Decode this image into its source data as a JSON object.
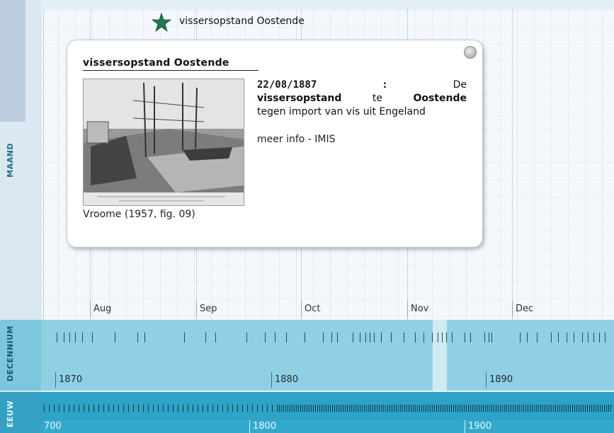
{
  "event": {
    "star_label": "vissersopstand Oostende",
    "popup_title": "vissersopstand Oostende",
    "date": "22/08/1887",
    "colon": ":",
    "desc_de": "De",
    "desc_word1": "vissersopstand",
    "desc_te": "te",
    "desc_place": "Oostende",
    "desc_rest": "tegen import van vis uit Engeland",
    "link": "meer info - IMIS",
    "source": "Vroome (1957, fig. 09)"
  },
  "bands": {
    "maand_label": "MAAND",
    "decennium_label": "DECENNIUM",
    "eeuw_label": "EEUW"
  },
  "months": [
    "Aug",
    "Sep",
    "Oct",
    "Nov",
    "Dec"
  ],
  "decades": [
    "1870",
    "1880",
    "1890"
  ],
  "centuries": [
    "700",
    "1800",
    "1900"
  ],
  "colors": {
    "decade_band": "#8fd0e4",
    "century_band": "#2ea2c7",
    "star": "#1f7a52"
  }
}
